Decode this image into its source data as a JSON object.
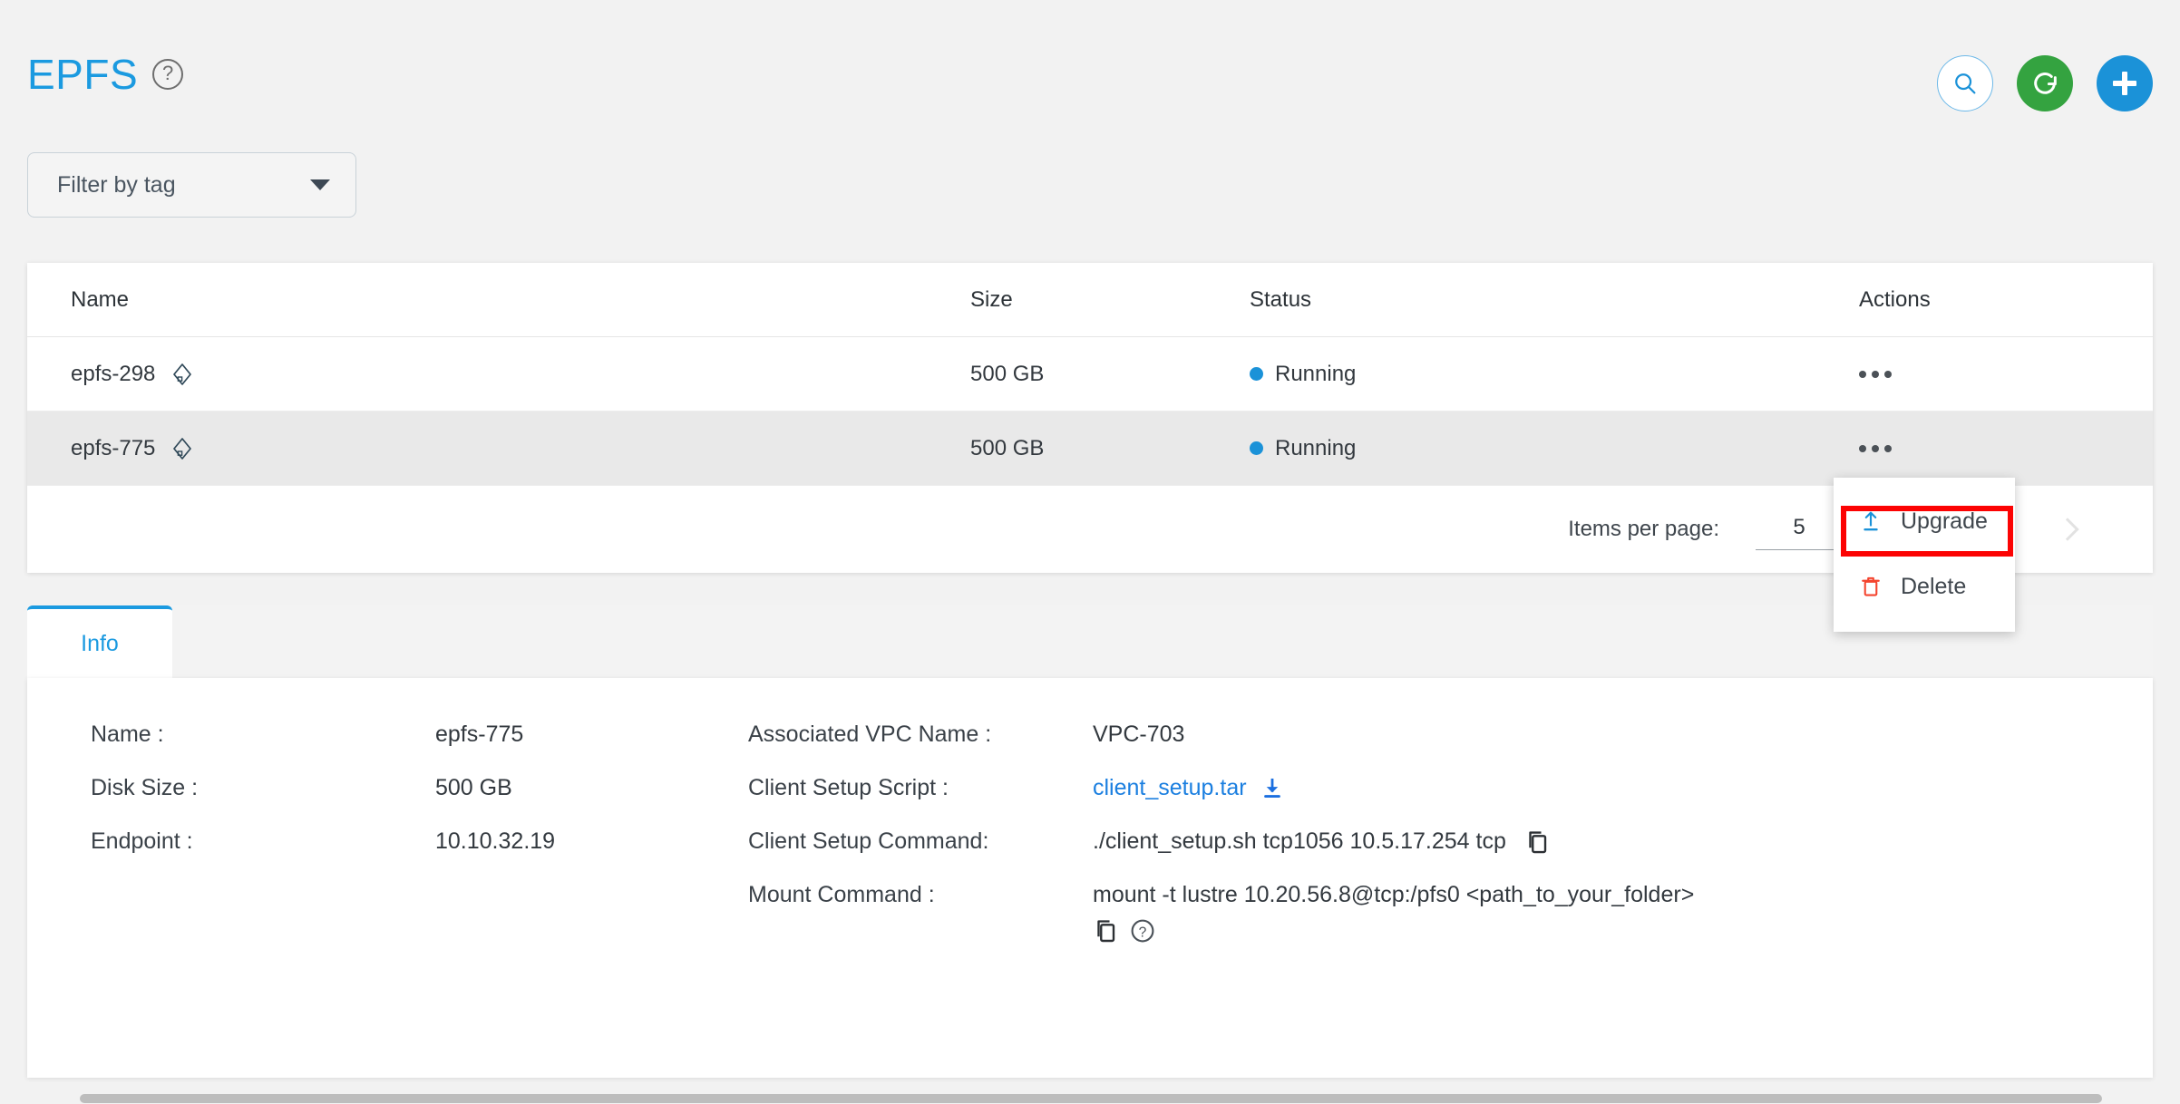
{
  "header": {
    "title": "EPFS",
    "help_icon": "help-circle-icon",
    "actions": [
      {
        "name": "search-button",
        "icon": "search-icon",
        "color": "#ffffff"
      },
      {
        "name": "refresh-button",
        "icon": "refresh-icon",
        "color": "#34a340"
      },
      {
        "name": "add-button",
        "icon": "plus-icon",
        "color": "#1b92d8"
      }
    ]
  },
  "filter": {
    "label": "Filter by tag",
    "icon": "chevron-down-icon"
  },
  "table": {
    "columns": [
      "Name",
      "Size",
      "Status",
      "Actions"
    ],
    "rows": [
      {
        "name": "epfs-298",
        "size": "500 GB",
        "status": "Running",
        "status_color": "#1b92d8",
        "selected": false
      },
      {
        "name": "epfs-775",
        "size": "500 GB",
        "status": "Running",
        "status_color": "#1b92d8",
        "selected": true
      }
    ]
  },
  "paginator": {
    "items_per_page_label": "Items per page:",
    "items_per_page_value": "5",
    "prev_icon": "chevron-left-icon",
    "next_icon": "chevron-right-icon"
  },
  "context_menu": {
    "items": [
      {
        "label": "Upgrade",
        "icon": "upload-arrow-icon",
        "icon_color": "#1b92d8",
        "highlighted": true
      },
      {
        "label": "Delete",
        "icon": "trash-icon",
        "icon_color": "#f4442e",
        "highlighted": false
      }
    ],
    "highlight_color": "#fc0303"
  },
  "tabs": [
    {
      "label": "Info",
      "active": true
    }
  ],
  "info": {
    "left": [
      {
        "label": "Name :",
        "value": "epfs-775"
      },
      {
        "label": "Disk Size :",
        "value": "500 GB"
      },
      {
        "label": "Endpoint :",
        "value": "10.10.32.19"
      }
    ],
    "right": [
      {
        "label": "Associated VPC Name :",
        "value": "VPC-703"
      },
      {
        "label": "Client Setup Script :",
        "value": "client_setup.tar",
        "is_link": true,
        "icon": "download-icon"
      },
      {
        "label": "Client Setup Command:",
        "value": "./client_setup.sh tcp1056 10.5.17.254 tcp",
        "icon": "copy-icon"
      },
      {
        "label": "Mount Command :",
        "value": "mount -t lustre 10.20.56.8@tcp:/pfs0 <path_to_your_folder>",
        "icon": "copy-icon",
        "icon2": "help-circle-icon"
      }
    ]
  }
}
